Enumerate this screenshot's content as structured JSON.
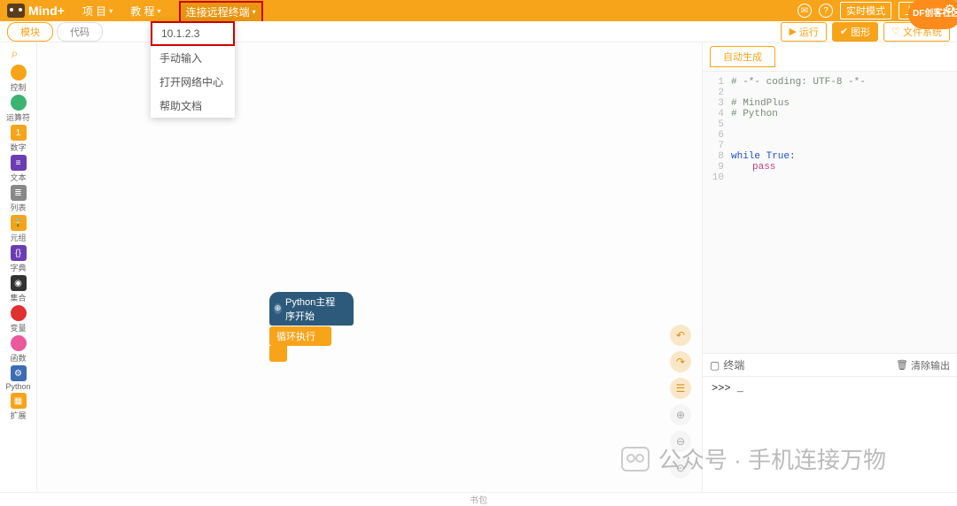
{
  "topbar": {
    "logo_text": "Mind+",
    "menus": {
      "project": "项 目",
      "tutorial": "教 程",
      "connect": "连接远程终端"
    },
    "modes": {
      "realtime": "实时模式",
      "upload": "上传模式"
    }
  },
  "dropdown": {
    "ip": "10.1.2.3",
    "manual": "手动输入",
    "netcenter": "打开网络中心",
    "help": "帮助文档"
  },
  "toolbar": {
    "tab_blocks": "模块",
    "tab_code": "代码",
    "run": "运行",
    "gui": "图形",
    "files": "文件系统"
  },
  "palette": [
    {
      "label": "控制",
      "color": "#f7a41a",
      "shape": "dot"
    },
    {
      "label": "运算符",
      "color": "#3cb371",
      "shape": "dot"
    },
    {
      "label": "数字",
      "color": "#f7a41a",
      "shape": "sq",
      "glyph": "1"
    },
    {
      "label": "文本",
      "color": "#6a3db3",
      "shape": "sq",
      "glyph": "≡"
    },
    {
      "label": "列表",
      "color": "#888",
      "shape": "sq",
      "glyph": "≣"
    },
    {
      "label": "元组",
      "color": "#f7a41a",
      "shape": "sq",
      "glyph": "🔒"
    },
    {
      "label": "字典",
      "color": "#6a3db3",
      "shape": "sq",
      "glyph": "{}"
    },
    {
      "label": "集合",
      "color": "#333",
      "shape": "sq",
      "glyph": "◉"
    },
    {
      "label": "变量",
      "color": "#e03030",
      "shape": "dot"
    },
    {
      "label": "函数",
      "color": "#e85a9a",
      "shape": "dot"
    },
    {
      "label": "Python",
      "color": "#3d6db3",
      "shape": "sq",
      "glyph": "⚙"
    },
    {
      "label": "扩展",
      "color": "#f7a41a",
      "shape": "sq",
      "glyph": "▦"
    }
  ],
  "blocks": {
    "hat": "Python主程序开始",
    "loop": "循环执行"
  },
  "code": {
    "tab": "自动生成",
    "lines": [
      {
        "n": 1,
        "t": "#  -*- coding: UTF-8 -*-",
        "cls": "c-comment"
      },
      {
        "n": 2,
        "t": "",
        "cls": ""
      },
      {
        "n": 3,
        "t": "# MindPlus",
        "cls": "c-comment"
      },
      {
        "n": 4,
        "t": "# Python",
        "cls": "c-comment"
      },
      {
        "n": 5,
        "t": "",
        "cls": ""
      },
      {
        "n": 6,
        "t": "",
        "cls": ""
      },
      {
        "n": 7,
        "t": "",
        "cls": ""
      },
      {
        "n": 8,
        "t": "while True:",
        "cls": "c-kw"
      },
      {
        "n": 9,
        "t": "pass",
        "cls": "c-stmt indent"
      },
      {
        "n": 10,
        "t": "",
        "cls": ""
      }
    ]
  },
  "terminal": {
    "title": "终端",
    "clear": "清除输出",
    "prompt": ">>> _"
  },
  "bottombar": {
    "backpack": "书包"
  },
  "watermark": {
    "text": "公众号 · 手机连接万物"
  },
  "df": {
    "text": "DF创客社区"
  }
}
